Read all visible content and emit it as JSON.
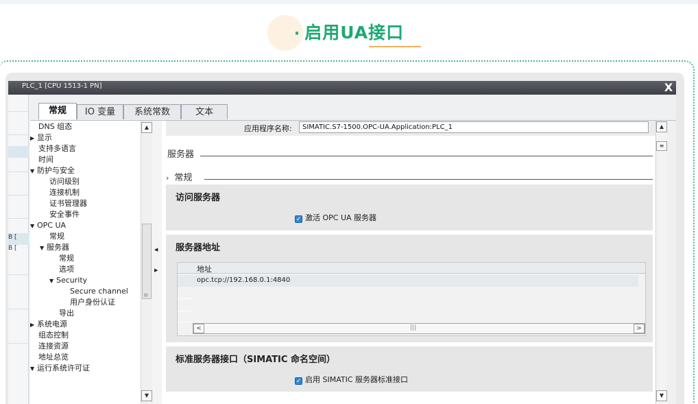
{
  "header": {
    "bullet": "·",
    "title": "启用UA接口"
  },
  "window": {
    "title": "PLC_1 [CPU 1513-1 PN]",
    "close_glyph": "X"
  },
  "background": {
    "side_labels": [
      "B [",
      "B ["
    ]
  },
  "tabs": [
    {
      "label": "常规",
      "active": true
    },
    {
      "label": "IO 变量",
      "active": false
    },
    {
      "label": "系统常数",
      "active": false
    },
    {
      "label": "文本",
      "active": false
    }
  ],
  "nav": {
    "items": [
      {
        "label": "DNS 组态"
      },
      {
        "label": "显示"
      },
      {
        "label": "支持多语言"
      },
      {
        "label": "时间"
      },
      {
        "label": "防护与安全"
      },
      {
        "label": "访问级别"
      },
      {
        "label": "连接机制"
      },
      {
        "label": "证书管理器"
      },
      {
        "label": "安全事件"
      },
      {
        "label": "OPC UA"
      },
      {
        "label": "常规"
      },
      {
        "label": "服务器"
      },
      {
        "label": "常规"
      },
      {
        "label": "选项"
      },
      {
        "label": "Security"
      },
      {
        "label": "Secure channel"
      },
      {
        "label": "用户身份认证"
      },
      {
        "label": "导出"
      },
      {
        "label": "系统电源"
      },
      {
        "label": "组态控制"
      },
      {
        "label": "连接资源"
      },
      {
        "label": "地址总览"
      },
      {
        "label": "运行系统许可证"
      }
    ]
  },
  "main": {
    "app_name_label": "应用程序名称:",
    "app_name_value": "SIMATIC.S7-1500.OPC-UA.Application:PLC_1",
    "server_section": "服务器",
    "general_section": "常规",
    "access_group": {
      "title": "访问服务器",
      "checkbox_label": "激活 OPC UA 服务器",
      "checked": true
    },
    "address_group": {
      "title": "服务器地址",
      "column_header": "地址",
      "rows": [
        "opc.tcp://192.168.0.1:4840"
      ]
    },
    "standard_group": {
      "title": "标准服务器接口（SIMATIC 命名空间）",
      "checkbox_label": "启用 SIMATIC 服务器标准接口",
      "checked": true
    }
  },
  "colors": {
    "accent": "#1fa874",
    "underline": "#f1b15a",
    "checkbox": "#2f86d6",
    "titlebar": "#4a4d53"
  }
}
